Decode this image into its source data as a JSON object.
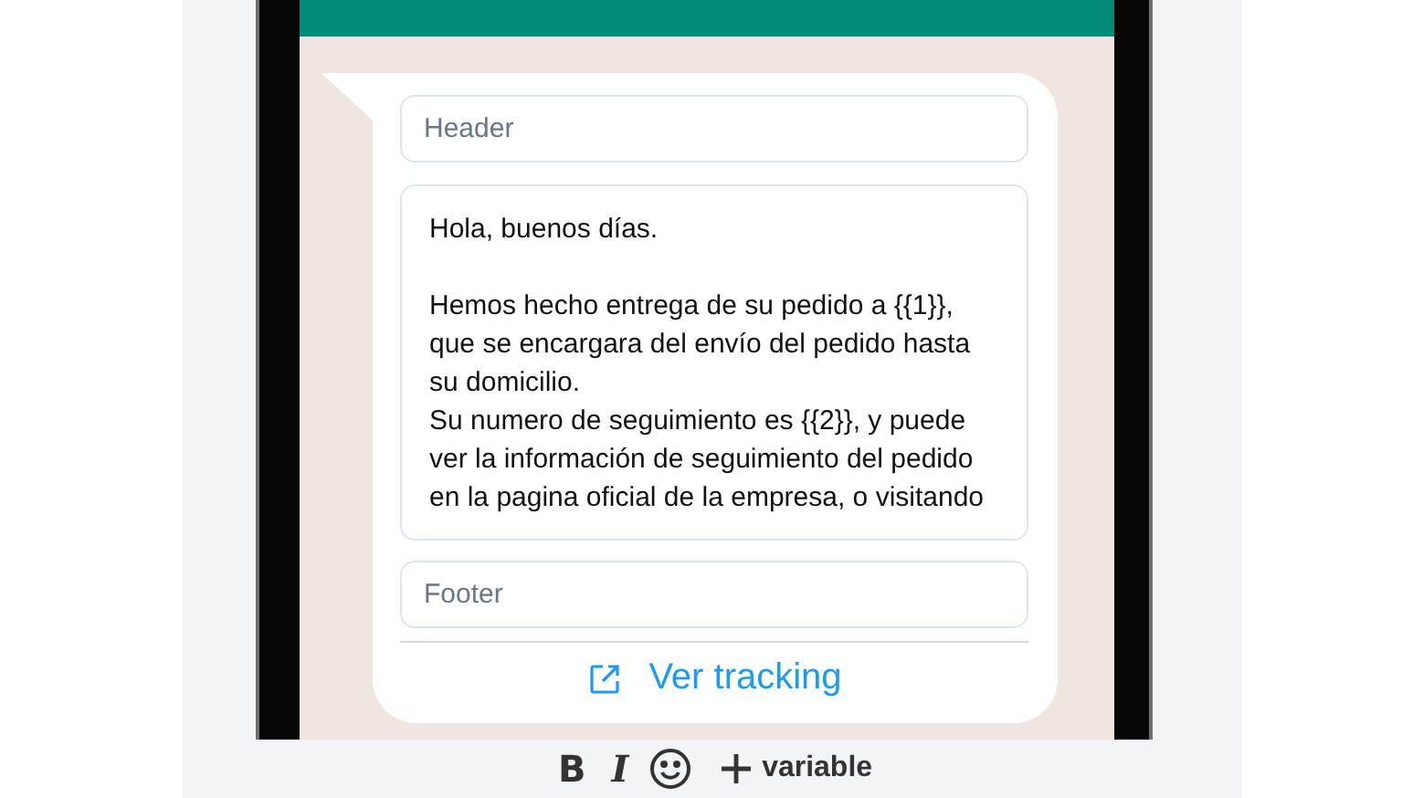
{
  "message": {
    "header": {
      "placeholder": "Header"
    },
    "body": {
      "value": "Hola, buenos días.\n\nHemos hecho entrega de su pedido a {{1}}, que se encargara del envío del pedido hasta su domicilio.\nSu numero de seguimiento es {{2}}, y puede ver la información de seguimiento del pedido en la pagina oficial de la empresa, o visitando"
    },
    "footer": {
      "placeholder": "Footer"
    },
    "button": {
      "label": "Ver tracking"
    }
  },
  "toolbar": {
    "bold": "B",
    "italic": "I",
    "variable": "variable"
  }
}
